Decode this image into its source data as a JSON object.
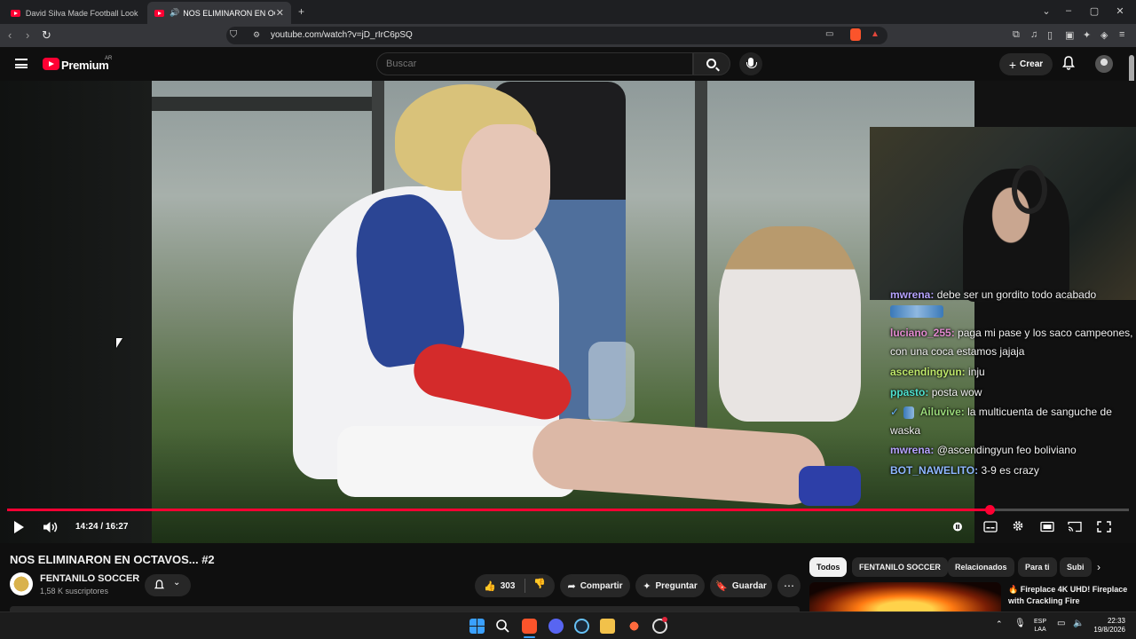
{
  "browser": {
    "tabs": [
      {
        "label": "David Silva Made Football Look Easy",
        "active": false
      },
      {
        "label": "NOS ELIMINARON EN OCTAVOS",
        "active": true
      }
    ],
    "url": "youtube.com/watch?v=jD_rIrC6pSQ"
  },
  "header": {
    "brand": "Premium",
    "region": "AR",
    "search_placeholder": "Buscar",
    "create_label": "Crear"
  },
  "player": {
    "current_time": "14:24",
    "duration": "16:27",
    "time_display": "14:24 / 16:27",
    "progress_fraction": 0.8754
  },
  "chat": [
    {
      "user": "mwrena:",
      "text": "debe ser un gordito todo acabado",
      "color": "#b6a3ff",
      "emote": false
    },
    {
      "user": "luciano_255:",
      "text": "paga mi pase y los saco campeones, con una coca estamos jajaja",
      "color": "#e38ad0",
      "emote": false
    },
    {
      "user": "ascendingyun:",
      "text": "inju",
      "color": "#bfe86b",
      "emote": false
    },
    {
      "user": "ppasto:",
      "text": "posta wow",
      "color": "#4ee0ce",
      "emote": false
    },
    {
      "user": "Ailuvive:",
      "text": "la multicuenta de sanguche de waska",
      "color": "#9ad97a",
      "emote": true
    },
    {
      "user": "mwrena:",
      "text": "@ascendingyun feo boliviano",
      "color": "#b6a3ff",
      "emote": false
    },
    {
      "user": "BOT_NAWELITO:",
      "text": "3-9 es crazy",
      "color": "#8fb8ff",
      "emote": false
    }
  ],
  "video": {
    "title": "NOS ELIMINARON EN OCTAVOS... #2",
    "channel": "FENTANILO SOCCER",
    "subscribers": "1,58 K suscriptores",
    "likes": "303",
    "share_label": "Compartir",
    "ask_label": "Preguntar",
    "save_label": "Guardar"
  },
  "chips": [
    {
      "label": "Todos",
      "active": true
    },
    {
      "label": "FENTANILO SOCCER",
      "active": false
    },
    {
      "label": "Relacionados",
      "active": false
    },
    {
      "label": "Para ti",
      "active": false
    },
    {
      "label": "Subi",
      "active": false
    }
  ],
  "recommendation": {
    "title": "Fireplace 4K UHD! Fireplace with Crackling Fire"
  },
  "taskbar": {
    "lang_line1": "ESP",
    "lang_line2": "LAA",
    "time": "22:33",
    "date": "19/8/2026"
  }
}
